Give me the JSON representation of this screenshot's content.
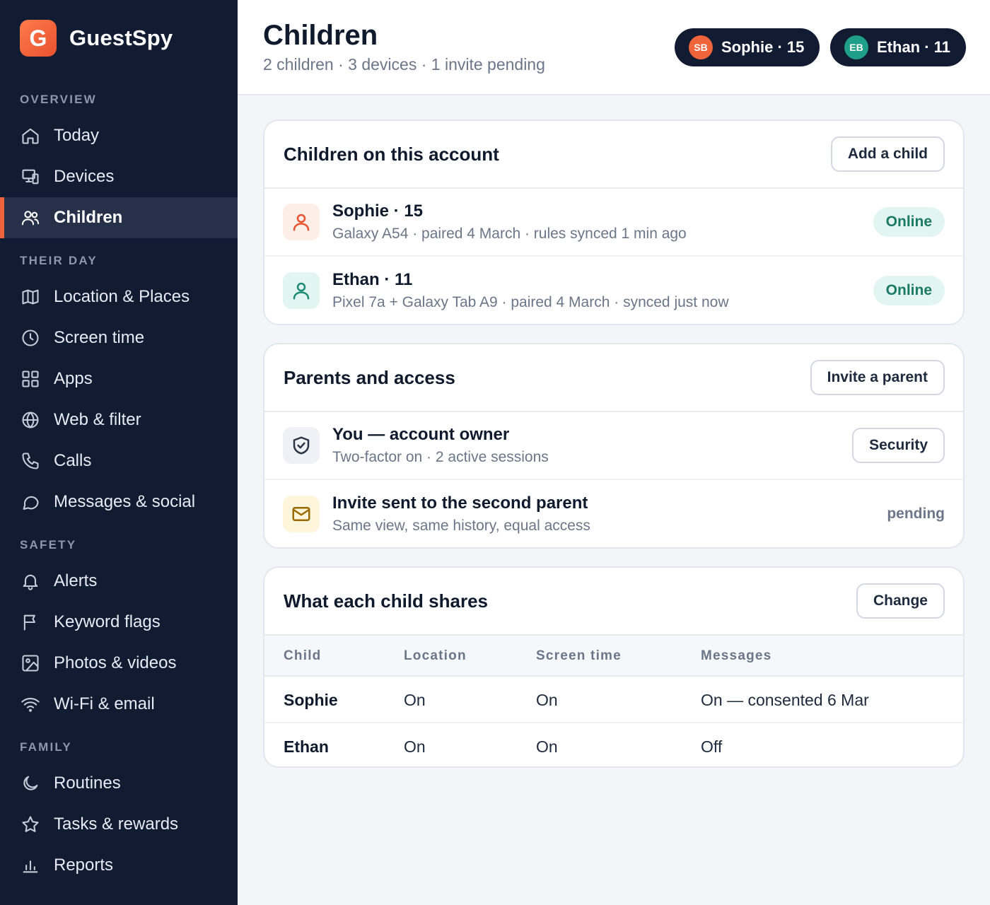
{
  "brand": {
    "logo_letter": "G",
    "name": "GuestSpy"
  },
  "sidebar": {
    "sections": {
      "overview": "OVERVIEW",
      "their_day": "THEIR DAY",
      "safety": "SAFETY",
      "family": "FAMILY"
    },
    "items": {
      "today": "Today",
      "devices": "Devices",
      "children": "Children",
      "location": "Location & Places",
      "screen_time": "Screen time",
      "apps": "Apps",
      "web": "Web & filter",
      "calls": "Calls",
      "messages": "Messages & social",
      "alerts": "Alerts",
      "keyword_flags": "Keyword flags",
      "photos": "Photos & videos",
      "wifi": "Wi-Fi & email",
      "routines": "Routines",
      "tasks": "Tasks & rewards",
      "reports": "Reports"
    },
    "active_item": "Children"
  },
  "header": {
    "title": "Children",
    "subtitle": "2 children · 3 devices · 1 invite pending",
    "pills": [
      {
        "initials": "SB",
        "label": "Sophie · 15",
        "color": "#f0643c"
      },
      {
        "initials": "EB",
        "label": "Ethan · 11",
        "color": "#1f9e8a"
      }
    ]
  },
  "children_card": {
    "title": "Children on this account",
    "button": "Add a child",
    "rows": [
      {
        "title": "Sophie · 15",
        "sub": "Galaxy A54 · paired 4 March · rules synced 1 min ago",
        "status": "Online"
      },
      {
        "title": "Ethan · 11",
        "sub": "Pixel 7a + Galaxy Tab A9 · paired 4 March · synced just now",
        "status": "Online"
      }
    ]
  },
  "parents_card": {
    "title": "Parents and access",
    "button": "Invite a parent",
    "rows": [
      {
        "title": "You — account owner",
        "sub": "Two-factor on · 2 active sessions",
        "action": "Security"
      },
      {
        "title": "Invite sent to the second parent",
        "sub": "Same view, same history, equal access",
        "status": "pending"
      }
    ]
  },
  "shares_card": {
    "title": "What each child shares",
    "button": "Change",
    "columns": [
      "Child",
      "Location",
      "Screen time",
      "Messages"
    ],
    "rows": [
      [
        "Sophie",
        "On",
        "On",
        "On — consented 6 Mar"
      ],
      [
        "Ethan",
        "On",
        "On",
        "Off"
      ]
    ]
  },
  "colors": {
    "sidebar_bg": "#111b32",
    "accent": "#f0643c",
    "online_bg": "#e3f5f1",
    "online_text": "#1b7a66"
  }
}
